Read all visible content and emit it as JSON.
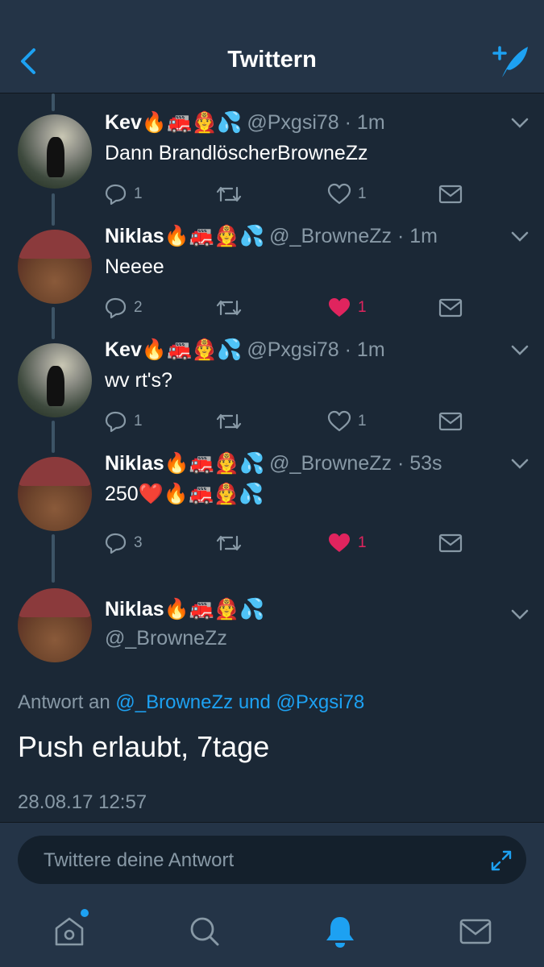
{
  "header": {
    "title": "Twittern",
    "back_icon": "chevron-left-icon",
    "compose_icon": "compose-tweet-icon"
  },
  "thread": [
    {
      "name": "Kev🔥🚒👨‍🚒💦",
      "handle": "@Pxgsi78",
      "time": "· 1m",
      "text": "Dann BrandlöscherBrowneZz",
      "replies": "1",
      "retweets": "",
      "likes": "1",
      "liked": false
    },
    {
      "name": "Niklas🔥🚒👨‍🚒💦",
      "handle": "@_BrowneZz",
      "time": "· 1m",
      "text": "Neeee",
      "replies": "2",
      "retweets": "",
      "likes": "1",
      "liked": true
    },
    {
      "name": "Kev🔥🚒👨‍🚒💦",
      "handle": "@Pxgsi78",
      "time": "· 1m",
      "text": "wv rt's?",
      "replies": "1",
      "retweets": "",
      "likes": "1",
      "liked": false
    },
    {
      "name": "Niklas🔥🚒👨‍🚒💦",
      "handle": "@_BrowneZz",
      "time": "· 53s",
      "text": "250❤️🔥🚒👨‍🚒💦",
      "replies": "3",
      "retweets": "",
      "likes": "1",
      "liked": true
    }
  ],
  "main_tweet": {
    "name": "Niklas🔥🚒👨‍🚒💦",
    "handle": "@_BrowneZz",
    "reply_prefix": "Antwort an",
    "reply_link": "@_BrowneZz und @Pxgsi78",
    "text": "Push erlaubt, 7tage",
    "date": "28.08.17 12:57"
  },
  "reply_bar": {
    "placeholder": "Twittere deine Antwort",
    "expand_icon": "expand-icon"
  },
  "tabbar": {
    "items": [
      "home-icon",
      "search-icon",
      "notifications-bell-icon",
      "messages-icon"
    ],
    "active": "notifications-bell-icon"
  },
  "colors": {
    "background": "#1b2836",
    "bar": "#243447",
    "accent": "#1da1f2",
    "secondary_text": "#8899a6",
    "like": "#e0245e"
  }
}
